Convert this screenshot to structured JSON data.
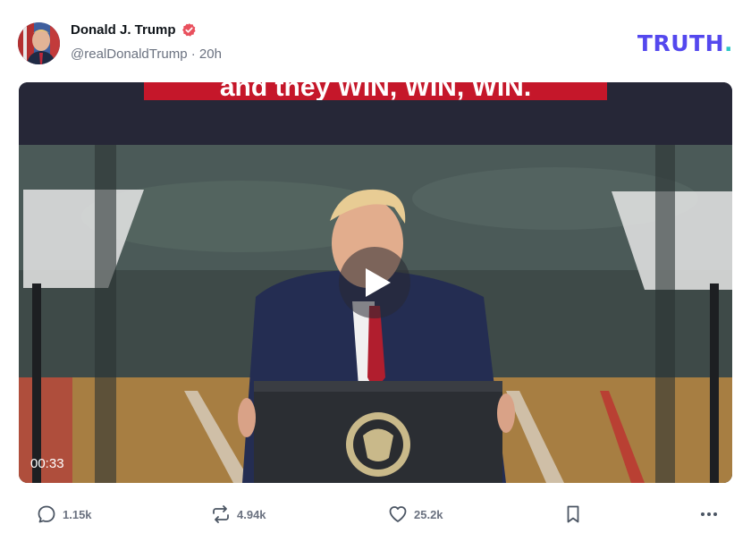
{
  "post": {
    "author": {
      "display_name": "Donald J. Trump",
      "handle": "@realDonaldTrump",
      "time_separator": "·",
      "time_ago": "20h",
      "verified_icon": "verified-badge-icon",
      "avatar_icon": "avatar"
    },
    "brand": {
      "logo_text": "TRUTH",
      "logo_dot": ".",
      "color": "#5448ee",
      "dot_color": "#2ec7c6"
    },
    "media": {
      "caption_text": "and they WIN, WIN, WIN.",
      "duration": "00:33",
      "play_icon": "play-icon"
    },
    "actions": {
      "reply": {
        "icon": "reply-icon",
        "count": "1.15k"
      },
      "repost": {
        "icon": "repost-icon",
        "count": "4.94k"
      },
      "like": {
        "icon": "heart-icon",
        "count": "25.2k"
      },
      "bookmark": {
        "icon": "bookmark-icon"
      },
      "more": {
        "icon": "more-options-icon"
      }
    },
    "colors": {
      "verified": "#e9505d",
      "muted_text": "#6b7280",
      "caption_red": "#c5172a"
    }
  }
}
